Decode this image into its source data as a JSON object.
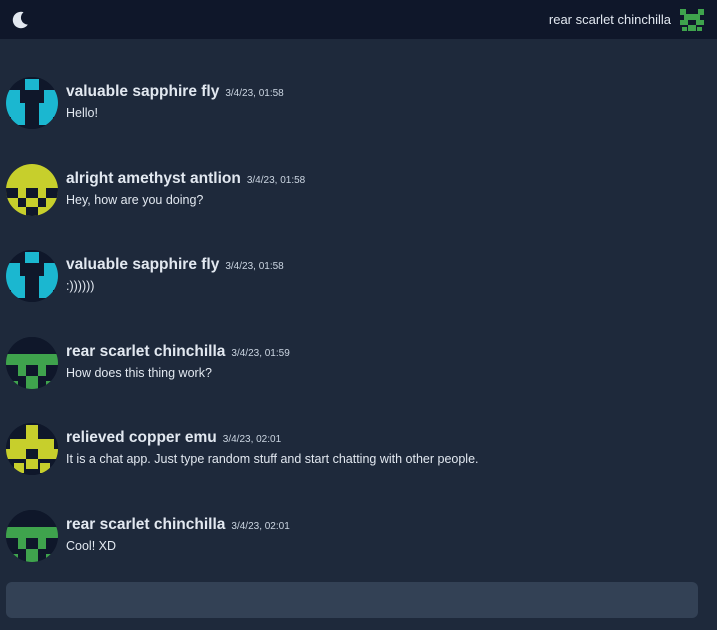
{
  "header": {
    "theme_toggle_icon": "moon-icon",
    "current_user": {
      "name": "rear scarlet chinchilla",
      "color": "#3fa34d"
    }
  },
  "messages": [
    {
      "user": "valuable sapphire fly",
      "time": "3/4/23, 01:58",
      "text": "Hello!",
      "avatar": "sapphire",
      "color": "#1bb7d0"
    },
    {
      "user": "alright amethyst antlion",
      "time": "3/4/23, 01:58",
      "text": "Hey, how are you doing?",
      "avatar": "amethyst",
      "color": "#c7cf2c"
    },
    {
      "user": "valuable sapphire fly",
      "time": "3/4/23, 01:58",
      "text": ":))))))",
      "avatar": "sapphire",
      "color": "#1bb7d0"
    },
    {
      "user": "rear scarlet chinchilla",
      "time": "3/4/23, 01:59",
      "text": "How does this thing work?",
      "avatar": "scarlet",
      "color": "#3fa34d"
    },
    {
      "user": "relieved copper emu",
      "time": "3/4/23, 02:01",
      "text": "It is a chat app. Just type random stuff and start chatting with other people.",
      "avatar": "copper",
      "color": "#c7cf2c"
    },
    {
      "user": "rear scarlet chinchilla",
      "time": "3/4/23, 02:01",
      "text": "Cool! XD",
      "avatar": "scarlet",
      "color": "#3fa34d"
    }
  ],
  "composer": {
    "value": "",
    "placeholder": ""
  }
}
